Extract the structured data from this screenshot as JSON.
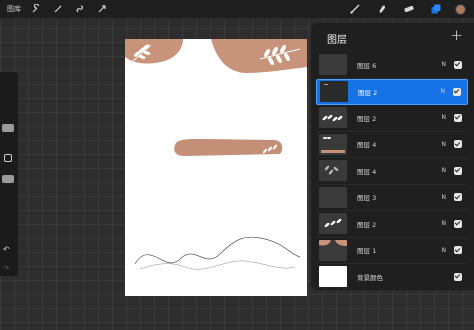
{
  "toolbar": {
    "gallery_label": "图库",
    "left_icons": [
      "wrench-icon",
      "magic-wand-icon",
      "selection-icon",
      "transform-arrow-icon"
    ],
    "right_icons": [
      "brush-icon",
      "smudge-icon",
      "eraser-icon",
      "layers-icon"
    ],
    "active_color": "#a97a5f"
  },
  "sidebar": {
    "undo": "↶",
    "redo": "↷"
  },
  "layers_panel": {
    "title": "图层",
    "add": "+",
    "layers": [
      {
        "name": "图层 6",
        "blend": "N",
        "visible": true,
        "selected": false
      },
      {
        "name": "图层 2",
        "blend": "N",
        "visible": true,
        "selected": true
      },
      {
        "name": "图层 2",
        "blend": "N",
        "visible": true,
        "selected": false
      },
      {
        "name": "图层 4",
        "blend": "N",
        "visible": true,
        "selected": false
      },
      {
        "name": "图层 4",
        "blend": "N",
        "visible": true,
        "selected": false
      },
      {
        "name": "图层 3",
        "blend": "N",
        "visible": true,
        "selected": false
      },
      {
        "name": "图层 2",
        "blend": "N",
        "visible": true,
        "selected": false
      },
      {
        "name": "图层 1",
        "blend": "N",
        "visible": true,
        "selected": false
      },
      {
        "name": "背景颜色",
        "blend": "",
        "visible": true,
        "selected": false
      }
    ]
  },
  "colors": {
    "accent": "#1673e6",
    "terracotta": "#c7937a"
  }
}
